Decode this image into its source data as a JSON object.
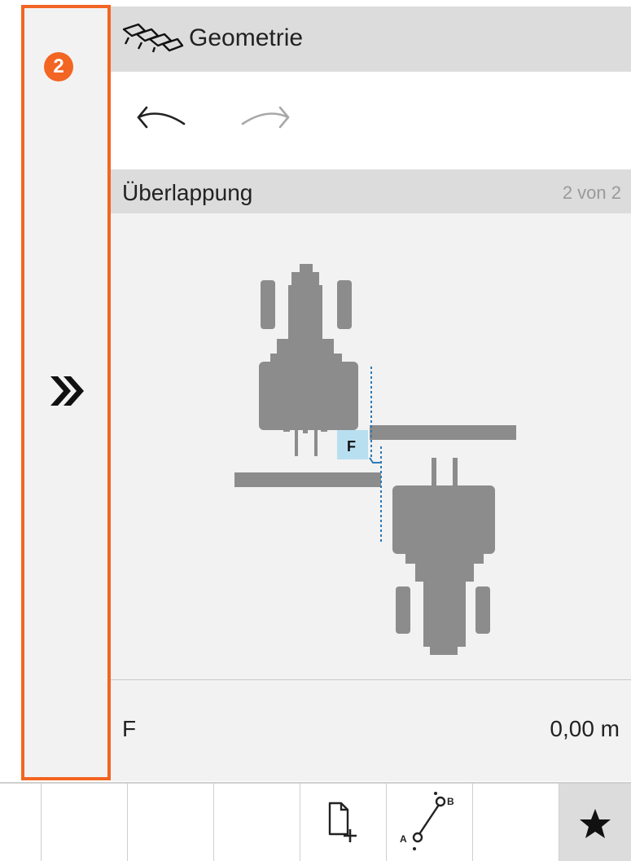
{
  "sidebar": {
    "badge": "2",
    "expand_icon": "double-chevron-right-icon"
  },
  "header": {
    "title": "Geometrie",
    "icon": "plough-icon"
  },
  "toolbar": {
    "undo_icon": "undo-icon",
    "redo_icon": "redo-icon"
  },
  "section": {
    "title": "Überlappung",
    "page": "2 von 2"
  },
  "diagram": {
    "marker_label": "F"
  },
  "value": {
    "label": "F",
    "value": "0,00 m"
  },
  "bottom_bar": {
    "buttons": [
      {
        "icon": "empty"
      },
      {
        "icon": "empty"
      },
      {
        "icon": "empty"
      },
      {
        "icon": "new-document-icon"
      },
      {
        "icon": "ab-line-icon",
        "label_a": "A",
        "label_b": "B"
      },
      {
        "icon": "empty"
      },
      {
        "icon": "star-icon",
        "selected": true
      }
    ]
  },
  "colors": {
    "accent": "#f26522",
    "machine": "#8c8c8c",
    "marker": "#b8dff0",
    "guide": "#2a7ab8"
  }
}
